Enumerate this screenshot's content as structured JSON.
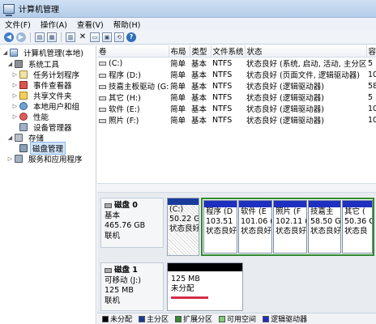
{
  "window": {
    "title": "计算机管理"
  },
  "menu": [
    "文件(F)",
    "操作(A)",
    "查看(V)",
    "帮助(H)"
  ],
  "toolbar": {
    "icons": [
      "back-icon",
      "forward-icon",
      "up-icon",
      "properties-icon",
      "tree-icon",
      "delete-icon",
      "folder-open-icon",
      "save-icon",
      "refresh-icon",
      "help-icon"
    ]
  },
  "tree": {
    "items": [
      {
        "label": "计算机管理(本地)",
        "level": 0,
        "expander": "◢"
      },
      {
        "label": "系统工具",
        "level": 1,
        "expander": "◢"
      },
      {
        "label": "任务计划程序",
        "level": 2,
        "expander": "▷"
      },
      {
        "label": "事件查看器",
        "level": 2,
        "expander": "▷"
      },
      {
        "label": "共享文件夹",
        "level": 2,
        "expander": "▷"
      },
      {
        "label": "本地用户和组",
        "level": 2,
        "expander": "▷"
      },
      {
        "label": "性能",
        "level": 2,
        "expander": "▷"
      },
      {
        "label": "设备管理器",
        "level": 2,
        "expander": ""
      },
      {
        "label": "存储",
        "level": 1,
        "expander": "◢"
      },
      {
        "label": "磁盘管理",
        "level": 2,
        "expander": "",
        "selected": true
      },
      {
        "label": "服务和应用程序",
        "level": 1,
        "expander": "▷"
      }
    ]
  },
  "volume_list": {
    "columns": [
      "卷",
      "布局",
      "类型",
      "文件系统",
      "状态",
      "容"
    ],
    "rows": [
      [
        "(C:)",
        "简单",
        "基本",
        "NTFS",
        "状态良好 (系统, 启动, 活动, 主分区)",
        "5"
      ],
      [
        "程序 (D:)",
        "简单",
        "基本",
        "NTFS",
        "状态良好 (页面文件, 逻辑驱动器)",
        "10"
      ],
      [
        "技嘉主板驱动 (G:)",
        "简单",
        "基本",
        "NTFS",
        "状态良好 (逻辑驱动器)",
        "58"
      ],
      [
        "其它 (H:)",
        "简单",
        "基本",
        "NTFS",
        "状态良好 (逻辑驱动器)",
        "5"
      ],
      [
        "软件 (E:)",
        "简单",
        "基本",
        "NTFS",
        "状态良好 (逻辑驱动器)",
        "10"
      ],
      [
        "照片 (F:)",
        "简单",
        "基本",
        "NTFS",
        "状态良好 (逻辑驱动器)",
        "10"
      ]
    ]
  },
  "disks": [
    {
      "name": "磁盘 0",
      "type": "基本",
      "size": "465.76 GB",
      "status": "联机",
      "partitions": [
        {
          "name": "(C:)",
          "size": "50.22 G",
          "status": "状态良好"
        },
        {
          "name": "程序 (D",
          "size": "103.51",
          "status": "状态良好"
        },
        {
          "name": "软件 (E",
          "size": "101.06 (",
          "status": "状态良好"
        },
        {
          "name": "照片 (F",
          "size": "102.11 (",
          "status": "状态良好"
        },
        {
          "name": "技嘉主",
          "size": "58.50 G",
          "status": "状态良好"
        },
        {
          "name": "其它 (",
          "size": "50.36 G",
          "status": "状态良"
        }
      ]
    },
    {
      "name": "磁盘 1",
      "type": "可移动 (J:)",
      "size": "125 MB",
      "status": "联机",
      "partitions": [
        {
          "name": "",
          "size": "125 MB",
          "status": "未分配"
        }
      ]
    }
  ],
  "legend": [
    {
      "label": "未分配",
      "color": "#000000"
    },
    {
      "label": "主分区",
      "color": "#1a3b9c"
    },
    {
      "label": "扩展分区",
      "color": "#2e8b2e"
    },
    {
      "label": "可用空间",
      "color": "#7fd06f"
    },
    {
      "label": "逻辑驱动器",
      "color": "#1f2fc0"
    }
  ],
  "colors": {
    "primary": "#1a3b9c",
    "logical": "#1f2fc0",
    "extended": "#2e8b2e",
    "unallocated": "#000000",
    "selection_underline": "#d62e4a"
  }
}
